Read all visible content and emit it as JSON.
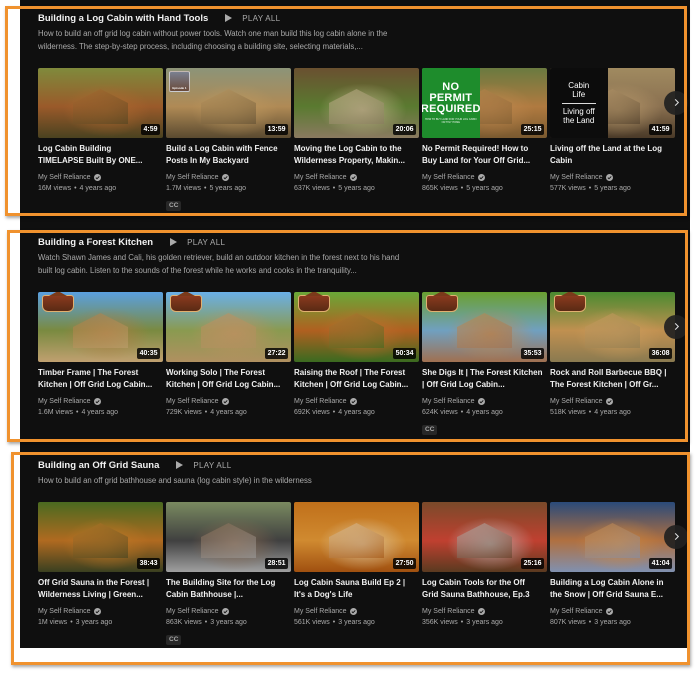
{
  "theme": {
    "background": "#0f0f0f",
    "frame": "#f0922e",
    "text_primary": "#f1f1f1",
    "text_secondary": "#aaaaaa",
    "cc_badge_bg": "#272727"
  },
  "labels": {
    "cc": "CC",
    "meta_separator": "•",
    "next_icon": "chevron-right-icon"
  },
  "sections": [
    {
      "title": "Building a Log Cabin with Hand Tools",
      "play_all": "PLAY ALL",
      "description": "How to build an off grid log cabin without power tools. Watch one man build this log cabin alone in the wilderness. The step-by-step process, including choosing a building site, selecting materials,...",
      "videos": [
        {
          "title": "Log Cabin Building TIMELAPSE Built By ONE...",
          "duration": "4:59",
          "channel": "My Self Reliance",
          "verified": true,
          "views": "16M views",
          "age": "4 years ago",
          "cc": false,
          "thumb": {
            "colors": [
              "#7f8a3c",
              "#9a5a2a",
              "#4a4220"
            ],
            "accent": "#b06a30"
          }
        },
        {
          "title": "Build a Log Cabin with Fence Posts In My Backyard",
          "duration": "13:59",
          "channel": "My Self Reliance",
          "verified": true,
          "views": "1.7M views",
          "age": "5 years ago",
          "cc": true,
          "thumb": {
            "colors": [
              "#8c9478",
              "#b08a55",
              "#5a4a30"
            ],
            "accent": "#c09a60",
            "inset_label": "Episode 1"
          }
        },
        {
          "title": "Moving the Log Cabin to the Wilderness Property, Makin...",
          "duration": "20:06",
          "channel": "My Self Reliance",
          "verified": true,
          "views": "637K views",
          "age": "5 years ago",
          "cc": false,
          "thumb": {
            "colors": [
              "#6a5030",
              "#5a7a30",
              "#8a7a60"
            ],
            "accent": "#c8b890"
          }
        },
        {
          "title": "No Permit Required! How to Buy Land for Your Off Grid...",
          "duration": "25:15",
          "channel": "My Self Reliance",
          "verified": true,
          "views": "865K views",
          "age": "5 years ago",
          "cc": false,
          "thumb": {
            "colors": [
              "#6a7a40",
              "#b07a40",
              "#7a5a30"
            ],
            "accent": "#c08a50",
            "panel": {
              "color": "#1e8c2c",
              "lines": [
                "NO",
                "PERMIT",
                "REQUIRED"
              ],
              "small": "HOW TO BUY LAND FOR YOUR LOG CABIN OR TINY HOME",
              "style": "big"
            }
          }
        },
        {
          "title": "Living off the Land at the Log Cabin",
          "duration": "41:59",
          "channel": "My Self Reliance",
          "verified": true,
          "views": "577K views",
          "age": "5 years ago",
          "cc": false,
          "thumb": {
            "colors": [
              "#a08a60",
              "#8a7050",
              "#4a3a28"
            ],
            "accent": "#c0a070",
            "panel": {
              "color": "#0c0c0c",
              "lines": [
                "Cabin",
                "Life"
              ],
              "lines2": [
                "Living off",
                "the Land"
              ],
              "style": "med"
            }
          }
        }
      ]
    },
    {
      "title": "Building a Forest Kitchen",
      "play_all": "PLAY ALL",
      "description": "Watch Shawn James and Cali, his golden retriever, build an outdoor kitchen in the forest next to his hand built log cabin. Listen to the sounds of the forest while he works and cooks in the tranquility...",
      "videos": [
        {
          "title": "Timber Frame | The Forest Kitchen | Off Grid Log Cabin...",
          "duration": "40:35",
          "channel": "My Self Reliance",
          "verified": true,
          "views": "1.6M views",
          "age": "4 years ago",
          "cc": false,
          "thumb": {
            "colors": [
              "#5aa0e0",
              "#7a8a40",
              "#c0a070"
            ],
            "accent": "#b07a40",
            "logo": true
          }
        },
        {
          "title": "Working Solo | The Forest Kitchen | Off Grid Log Cabin...",
          "duration": "27:22",
          "channel": "My Self Reliance",
          "verified": true,
          "views": "729K views",
          "age": "4 years ago",
          "cc": false,
          "thumb": {
            "colors": [
              "#6ab0e8",
              "#8a9a50",
              "#b09060"
            ],
            "accent": "#c09060",
            "logo": true
          }
        },
        {
          "title": "Raising the Roof | The Forest Kitchen | Off Grid Log Cabin...",
          "duration": "50:34",
          "channel": "My Self Reliance",
          "verified": true,
          "views": "692K views",
          "age": "4 years ago",
          "cc": false,
          "thumb": {
            "colors": [
              "#6aa838",
              "#b06020",
              "#3a6a20"
            ],
            "accent": "#c07030",
            "logo": true
          }
        },
        {
          "title": "She Digs It | The Forest Kitchen | Off Grid Log Cabin...",
          "duration": "35:53",
          "channel": "My Self Reliance",
          "verified": true,
          "views": "624K views",
          "age": "4 years ago",
          "cc": true,
          "thumb": {
            "colors": [
              "#6aa030",
              "#70a0c0",
              "#a07050"
            ],
            "accent": "#c08a50",
            "logo": true
          }
        },
        {
          "title": "Rock and Roll Barbecue BBQ | The Forest Kitchen | Off Gr...",
          "duration": "36:08",
          "channel": "My Self Reliance",
          "verified": true,
          "views": "518K views",
          "age": "4 years ago",
          "cc": false,
          "thumb": {
            "colors": [
              "#4a8a30",
              "#c09050",
              "#8a7a50"
            ],
            "accent": "#d0a060",
            "logo": true
          }
        }
      ]
    },
    {
      "title": "Building an Off Grid Sauna",
      "play_all": "PLAY ALL",
      "description": "How to build an off grid bathhouse and sauna (log cabin style) in the wilderness",
      "videos": [
        {
          "title": "Off Grid Sauna in the Forest | Wilderness Living | Green...",
          "duration": "38:43",
          "channel": "My Self Reliance",
          "verified": true,
          "views": "1M views",
          "age": "3 years ago",
          "cc": false,
          "thumb": {
            "colors": [
              "#4a6a20",
              "#b06a20",
              "#3a4020"
            ],
            "accent": "#c07a28"
          }
        },
        {
          "title": "The Building Site for the Log Cabin Bathhouse |...",
          "duration": "28:51",
          "channel": "My Self Reliance",
          "verified": true,
          "views": "863K views",
          "age": "3 years ago",
          "cc": true,
          "thumb": {
            "colors": [
              "#7a8a60",
              "#404040",
              "#a0a0a0"
            ],
            "accent": "#8a6a50"
          }
        },
        {
          "title": "Log Cabin Sauna Build Ep 2 | It's a Dog's Life",
          "duration": "27:50",
          "channel": "My Self Reliance",
          "verified": true,
          "views": "561K views",
          "age": "3 years ago",
          "cc": false,
          "thumb": {
            "colors": [
              "#c0701a",
              "#d08a30",
              "#a05010"
            ],
            "accent": "#e0d0b0"
          }
        },
        {
          "title": "Log Cabin Tools for the Off Grid Sauna Bathhouse, Ep.3",
          "duration": "25:16",
          "channel": "My Self Reliance",
          "verified": true,
          "views": "356K views",
          "age": "3 years ago",
          "cc": false,
          "thumb": {
            "colors": [
              "#7a4a2a",
              "#c04030",
              "#5a3a20"
            ],
            "accent": "#c0c0c0"
          }
        },
        {
          "title": "Building a Log Cabin Alone in the Snow | Off Grid Sauna E...",
          "duration": "41:04",
          "channel": "My Self Reliance",
          "verified": true,
          "views": "807K views",
          "age": "3 years ago",
          "cc": false,
          "thumb": {
            "colors": [
              "#2a4a7a",
              "#b07040",
              "#8090b0"
            ],
            "accent": "#d08a40"
          }
        }
      ]
    }
  ]
}
